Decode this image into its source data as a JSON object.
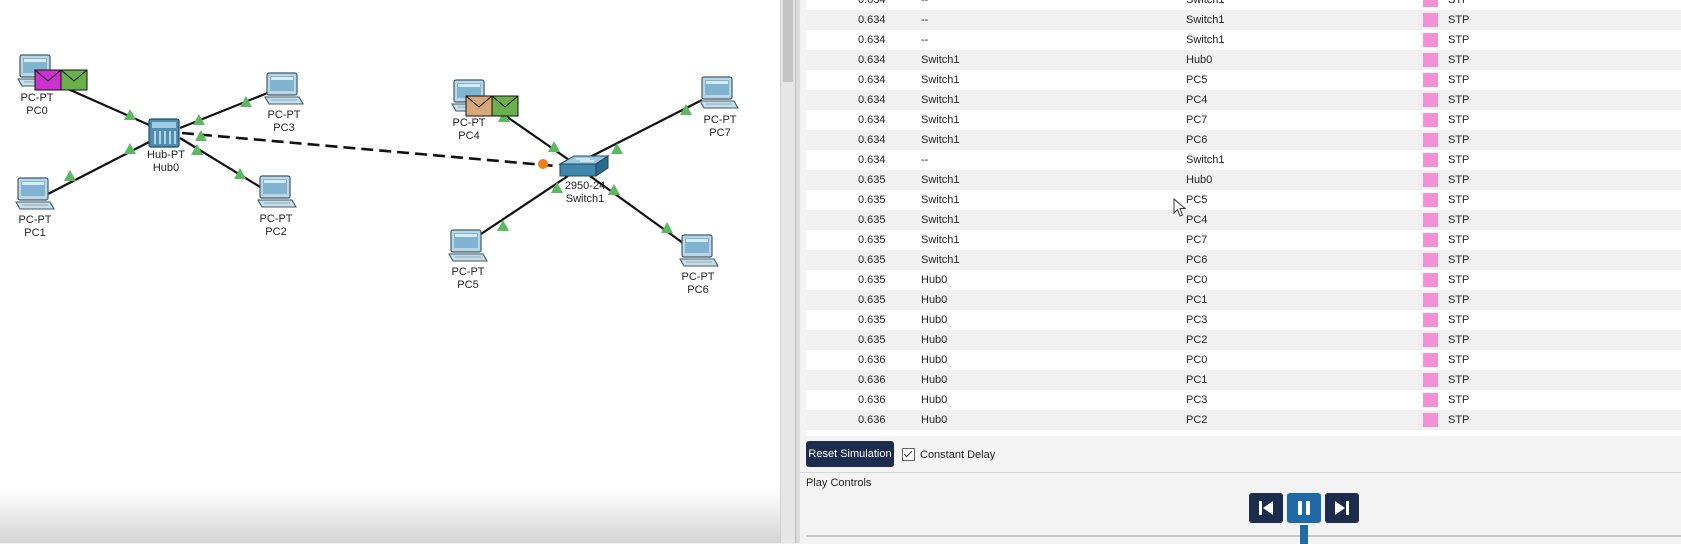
{
  "topology": {
    "nodes": [
      {
        "id": "pc0",
        "model": "PC-PT",
        "name": "PC0"
      },
      {
        "id": "pc1",
        "model": "PC-PT",
        "name": "PC1"
      },
      {
        "id": "pc2",
        "model": "PC-PT",
        "name": "PC2"
      },
      {
        "id": "pc3",
        "model": "PC-PT",
        "name": "PC3"
      },
      {
        "id": "hub0",
        "model": "Hub-PT",
        "name": "Hub0"
      },
      {
        "id": "pc4",
        "model": "PC-PT",
        "name": "PC4"
      },
      {
        "id": "pc5",
        "model": "PC-PT",
        "name": "PC5"
      },
      {
        "id": "pc6",
        "model": "PC-PT",
        "name": "PC6"
      },
      {
        "id": "pc7",
        "model": "PC-PT",
        "name": "PC7"
      },
      {
        "id": "switch1",
        "model": "2950-24",
        "name": "Switch1"
      }
    ],
    "link_status_color": "#5cb85c",
    "pending_port_color": "#f07f14",
    "envelope_colors": {
      "pink": "#cc33cc",
      "green": "#6ab04c",
      "tan": "#d8a878"
    }
  },
  "event_list": {
    "rows": [
      {
        "time": "0.634",
        "last_device": "--",
        "at_device": "Switch1",
        "type": "STP"
      },
      {
        "time": "0.634",
        "last_device": "--",
        "at_device": "Switch1",
        "type": "STP"
      },
      {
        "time": "0.634",
        "last_device": "--",
        "at_device": "Switch1",
        "type": "STP"
      },
      {
        "time": "0.634",
        "last_device": "Switch1",
        "at_device": "Hub0",
        "type": "STP"
      },
      {
        "time": "0.634",
        "last_device": "Switch1",
        "at_device": "PC5",
        "type": "STP"
      },
      {
        "time": "0.634",
        "last_device": "Switch1",
        "at_device": "PC4",
        "type": "STP"
      },
      {
        "time": "0.634",
        "last_device": "Switch1",
        "at_device": "PC7",
        "type": "STP"
      },
      {
        "time": "0.634",
        "last_device": "Switch1",
        "at_device": "PC6",
        "type": "STP"
      },
      {
        "time": "0.634",
        "last_device": "--",
        "at_device": "Switch1",
        "type": "STP"
      },
      {
        "time": "0.635",
        "last_device": "Switch1",
        "at_device": "Hub0",
        "type": "STP"
      },
      {
        "time": "0.635",
        "last_device": "Switch1",
        "at_device": "PC5",
        "type": "STP"
      },
      {
        "time": "0.635",
        "last_device": "Switch1",
        "at_device": "PC4",
        "type": "STP"
      },
      {
        "time": "0.635",
        "last_device": "Switch1",
        "at_device": "PC7",
        "type": "STP"
      },
      {
        "time": "0.635",
        "last_device": "Switch1",
        "at_device": "PC6",
        "type": "STP"
      },
      {
        "time": "0.635",
        "last_device": "Hub0",
        "at_device": "PC0",
        "type": "STP"
      },
      {
        "time": "0.635",
        "last_device": "Hub0",
        "at_device": "PC1",
        "type": "STP"
      },
      {
        "time": "0.635",
        "last_device": "Hub0",
        "at_device": "PC3",
        "type": "STP"
      },
      {
        "time": "0.635",
        "last_device": "Hub0",
        "at_device": "PC2",
        "type": "STP"
      },
      {
        "time": "0.636",
        "last_device": "Hub0",
        "at_device": "PC0",
        "type": "STP"
      },
      {
        "time": "0.636",
        "last_device": "Hub0",
        "at_device": "PC1",
        "type": "STP"
      },
      {
        "time": "0.636",
        "last_device": "Hub0",
        "at_device": "PC3",
        "type": "STP"
      },
      {
        "time": "0.636",
        "last_device": "Hub0",
        "at_device": "PC2",
        "type": "STP"
      }
    ],
    "stp_color": "#f58fd6"
  },
  "simulation_bar": {
    "reset_label": "Reset Simulation",
    "constant_delay_label": "Constant Delay",
    "constant_delay_checked": true
  },
  "play_controls": {
    "title": "Play Controls",
    "buttons": [
      {
        "name": "step-back",
        "icon": "skip-back-icon"
      },
      {
        "name": "pause",
        "icon": "pause-icon"
      },
      {
        "name": "step-forward",
        "icon": "skip-forward-icon"
      }
    ]
  }
}
